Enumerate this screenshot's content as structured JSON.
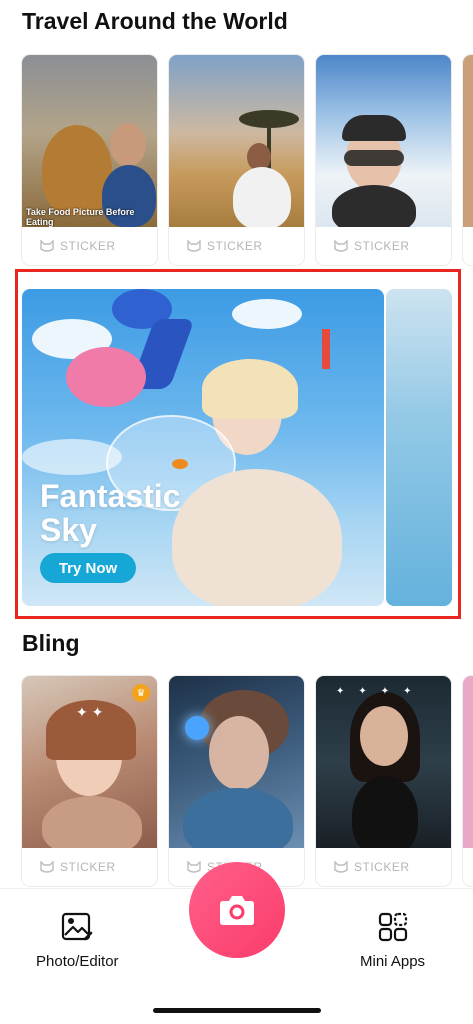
{
  "sections": {
    "travel": {
      "title": "Travel Around the World",
      "cards": [
        {
          "tag": "STICKER",
          "caption": "Take Food Picture Before Eating"
        },
        {
          "tag": "STICKER"
        },
        {
          "tag": "STICKER"
        }
      ]
    },
    "banner": {
      "title_line1": "Fantastic",
      "title_line2": "Sky",
      "button": "Try Now"
    },
    "bling": {
      "title": "Bling",
      "cards": [
        {
          "tag": "STICKER"
        },
        {
          "tag": "STICKER"
        },
        {
          "tag": "STICKER"
        }
      ]
    }
  },
  "tabbar": {
    "left_label": "Photo/Editor",
    "left_icon": "photo-edit-icon",
    "center_icon": "camera-icon",
    "right_label": "Mini Apps",
    "right_icon": "mini-apps-icon"
  },
  "colors": {
    "highlight_outline": "#e8261d",
    "camera_button": "#fb3c6b",
    "try_button": "#17a7d6",
    "sticker_tag": "#b5b5b5"
  }
}
